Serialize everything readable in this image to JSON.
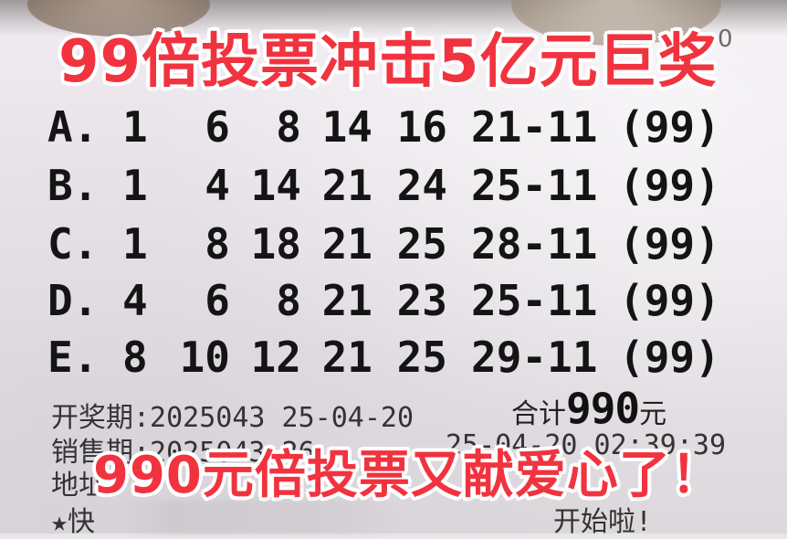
{
  "headline_top": "99倍投票冲击5亿元巨奖",
  "headline_bottom": "990元倍投票又献爱心了！",
  "corner_char": "0",
  "rows": [
    {
      "label": "A.",
      "nums": [
        "1",
        "6",
        "8",
        "14",
        "16"
      ],
      "blue": "21-11",
      "mult": "(99)"
    },
    {
      "label": "B.",
      "nums": [
        "1",
        "4",
        "14",
        "21",
        "24"
      ],
      "blue": "25-11",
      "mult": "(99)"
    },
    {
      "label": "C.",
      "nums": [
        "1",
        "8",
        "18",
        "21",
        "25"
      ],
      "blue": "28-11",
      "mult": "(99)"
    },
    {
      "label": "D.",
      "nums": [
        "4",
        "6",
        "8",
        "21",
        "23"
      ],
      "blue": "25-11",
      "mult": "(99)"
    },
    {
      "label": "E.",
      "nums": [
        "8",
        "10",
        "12",
        "21",
        "25"
      ],
      "blue": "29-11",
      "mult": "(99)"
    }
  ],
  "draw_info": "开奖期:2025043 25-04-20",
  "total": {
    "label": "合计",
    "amount": "990",
    "unit": "元"
  },
  "sale_info": "销售期:2025043-26",
  "sale_time": "25-04-20 02:39:39",
  "address_prefix": "地址",
  "star_line": "★快",
  "footer_right": "开始啦!",
  "colors": {
    "headline": "#f1333f",
    "outline": "#ffffff",
    "ink": "#141414",
    "paper": "#e9e6e9"
  }
}
